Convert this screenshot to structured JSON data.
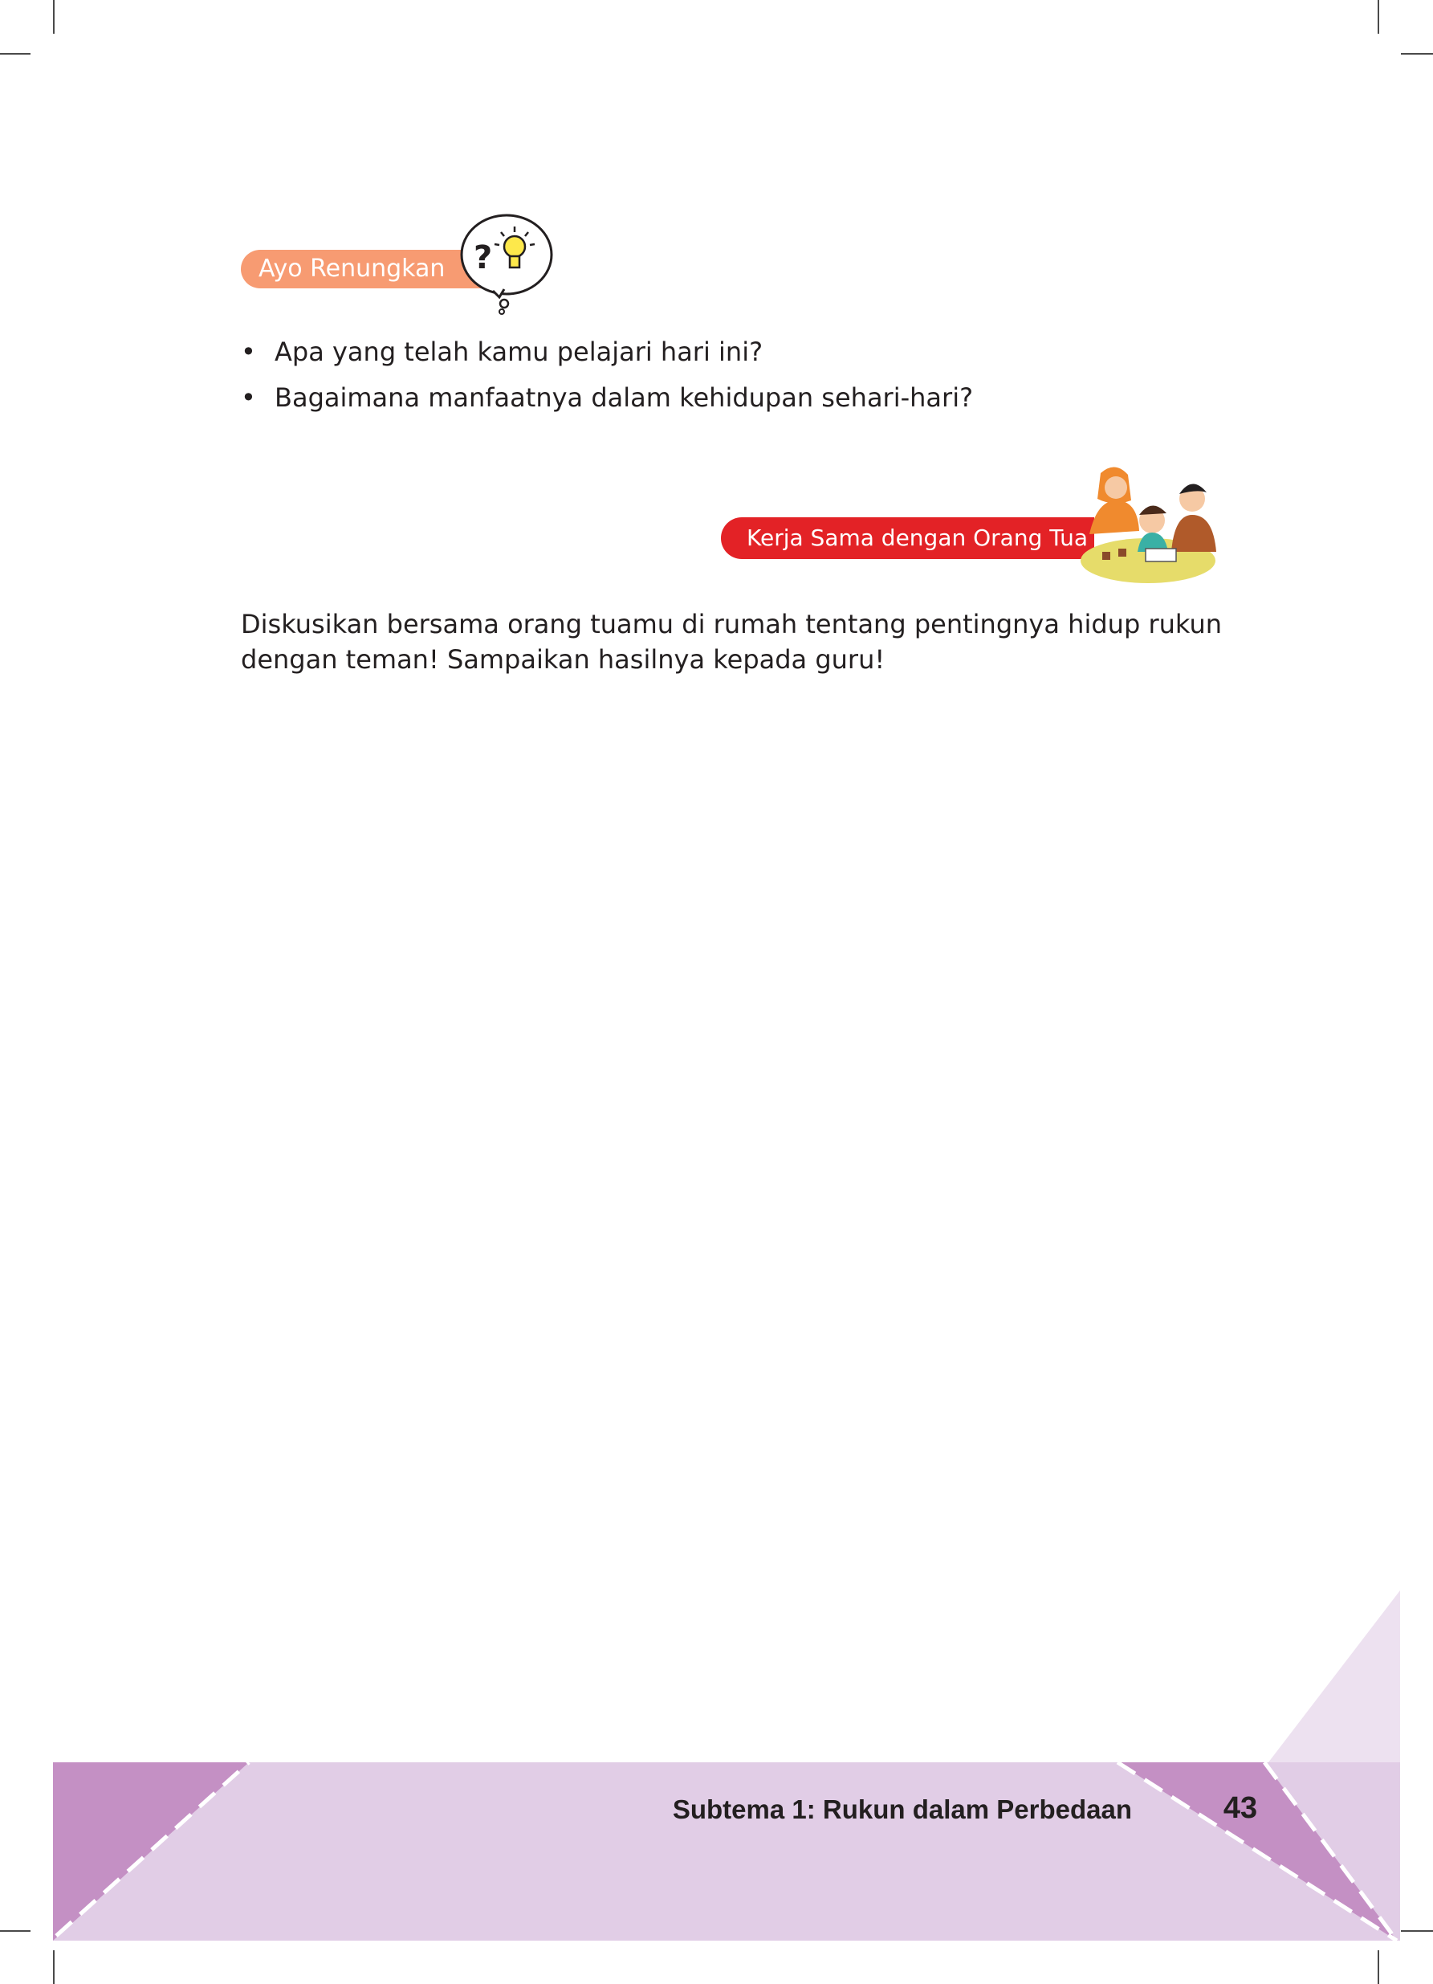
{
  "reflection": {
    "heading": "Ayo Renungkan",
    "icon": "question-lightbulb-thought-icon",
    "questions": [
      "Apa yang telah kamu pelajari hari ini?",
      "Bagaimana manfaatnya dalam kehidupan sehari-hari?"
    ]
  },
  "parent_activity": {
    "heading": "Kerja Sama dengan Orang Tua",
    "illustration": "family-study-illustration",
    "text": "Diskusikan bersama orang tuamu di rumah tentang pentingnya hidup rukun dengan teman! Sampaikan hasilnya kepada guru!"
  },
  "footer": {
    "subtheme": "Subtema 1: Rukun dalam Perbedaan",
    "page_number": "43"
  },
  "colors": {
    "reflection_badge": "#f79b72",
    "parent_badge": "#e32226",
    "footer_band": "#e1cde6",
    "footer_accent": "#c490c4",
    "footer_corner": "#ede1f0"
  }
}
